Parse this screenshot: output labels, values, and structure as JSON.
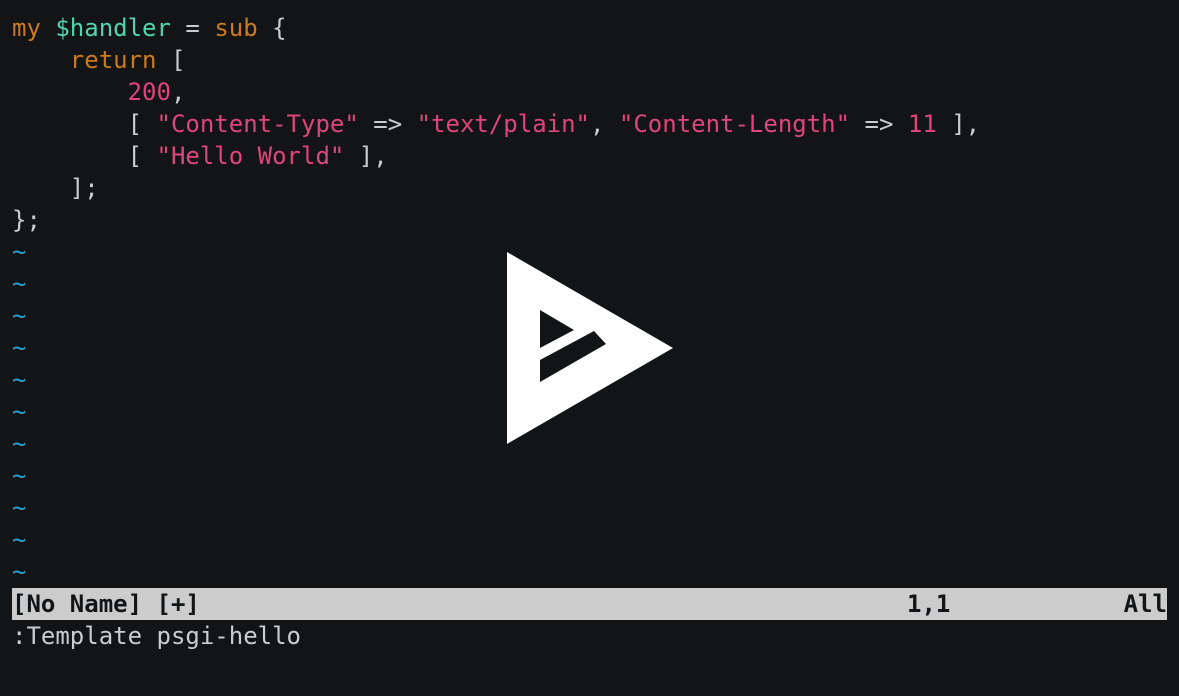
{
  "editor": {
    "code_lines": [
      {
        "t1": "my",
        "t2": " ",
        "t3": "$handler",
        "t4": " = ",
        "t5": "sub",
        "t6": " {"
      },
      {
        "indent": "    ",
        "kw": "return",
        "rest": " ["
      },
      {
        "indent": "        ",
        "num": "200",
        "rest": ","
      },
      {
        "indent": "        ",
        "open": "[ ",
        "s1": "\"Content-Type\"",
        "arrow1": " => ",
        "s2": "\"text/plain\"",
        "comma": ", ",
        "s3": "\"Content-Length\"",
        "arrow2": " => ",
        "n": "11",
        "close": " ],"
      },
      {
        "indent": "        ",
        "open": "[ ",
        "s1": "\"Hello World\"",
        "close": " ],"
      },
      {
        "text": "    ];"
      },
      {
        "text": "};"
      }
    ],
    "tilde": "~"
  },
  "statusline": {
    "filename": "[No Name] [+]",
    "position": "1,1",
    "percent": "All"
  },
  "cmdline": {
    "text": ":Template psgi-hello"
  },
  "overlay": {
    "icon": "asciinema-play-icon",
    "color": "#ffffff"
  }
}
